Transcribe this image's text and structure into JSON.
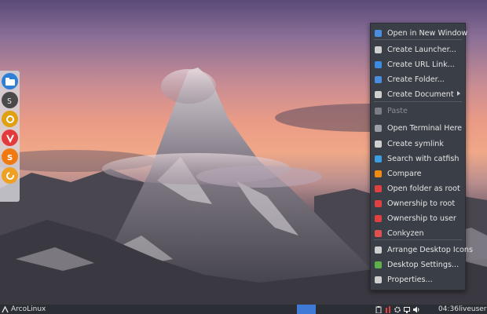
{
  "desktop": {
    "wallpaper": "mountain-sunset"
  },
  "dock": {
    "items": [
      {
        "name": "files-icon",
        "color": "#2f7fd6"
      },
      {
        "name": "terminal-icon",
        "color": "#4a4a4a"
      },
      {
        "name": "settings-icon",
        "color": "#e0a010"
      },
      {
        "name": "vivaldi-icon",
        "color": "#e33b3b"
      },
      {
        "name": "switcher-icon",
        "color": "#f07a10"
      },
      {
        "name": "update-icon",
        "color": "#f0a020"
      }
    ]
  },
  "context_menu": {
    "items": [
      {
        "label": "Open in New Window",
        "icon": "folder-icon",
        "color": "#4a8ee0"
      },
      {
        "label": "Create Launcher...",
        "icon": "launcher-icon",
        "color": "#cfcfcf"
      },
      {
        "label": "Create URL Link...",
        "icon": "link-icon",
        "color": "#3c8de0"
      },
      {
        "label": "Create Folder...",
        "icon": "folder-icon",
        "color": "#4a8ee0"
      },
      {
        "label": "Create Document",
        "icon": "document-icon",
        "color": "#cfcfcf",
        "submenu": true
      },
      {
        "label": "Paste",
        "icon": "paste-icon",
        "color": "#7a7d83",
        "disabled": true
      },
      {
        "label": "Open Terminal Here",
        "icon": "terminal-icon",
        "color": "#9aa0a6"
      },
      {
        "label": "Create symlink",
        "icon": "symlink-icon",
        "color": "#cfcfcf"
      },
      {
        "label": "Search with catfish",
        "icon": "search-icon",
        "color": "#3c9de0"
      },
      {
        "label": "Compare",
        "icon": "compare-icon",
        "color": "#f08a10"
      },
      {
        "label": "Open folder as root",
        "icon": "root-folder-icon",
        "color": "#e04040"
      },
      {
        "label": "Ownership to root",
        "icon": "ownership-root-icon",
        "color": "#e04040"
      },
      {
        "label": "Ownership to user",
        "icon": "ownership-user-icon",
        "color": "#e04040"
      },
      {
        "label": "Conkyzen",
        "icon": "conky-icon",
        "color": "#e05050"
      },
      {
        "label": "Arrange Desktop Icons",
        "icon": "arrange-icon",
        "color": "#cfcfcf"
      },
      {
        "label": "Desktop Settings...",
        "icon": "desktop-settings-icon",
        "color": "#5fb04a"
      },
      {
        "label": "Properties...",
        "icon": "properties-icon",
        "color": "#cfcfcf"
      }
    ]
  },
  "panel": {
    "brand": "ArcoLinux",
    "clock": "04:36",
    "user": "liveuser",
    "tray": [
      "clipboard-icon",
      "network-icon",
      "settings-icon",
      "display-icon",
      "volume-icon"
    ]
  }
}
